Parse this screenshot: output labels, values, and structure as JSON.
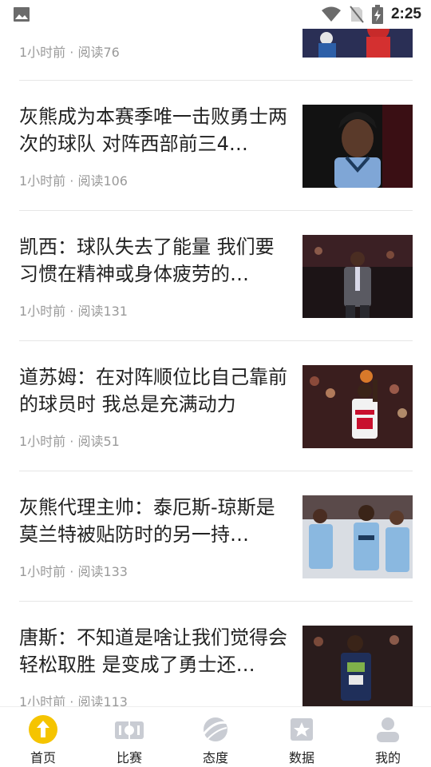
{
  "status_bar": {
    "time": "2:25",
    "icons": [
      "image-icon",
      "wifi-icon",
      "no-sim-icon",
      "battery-charging-icon"
    ]
  },
  "articles": [
    {
      "title": "",
      "meta": "1小时前 · 阅读76"
    },
    {
      "title": "灰熊成为本赛季唯一击败勇士两次的球队 对阵西部前三4…",
      "meta": "1小时前 · 阅读106"
    },
    {
      "title": "凯西：球队失去了能量 我们要习惯在精神或身体疲劳的…",
      "meta": "1小时前 · 阅读131"
    },
    {
      "title": "道苏姆：在对阵顺位比自己靠前的球员时 我总是充满动力",
      "meta": "1小时前 · 阅读51"
    },
    {
      "title": "灰熊代理主帅：泰厄斯-琼斯是莫兰特被贴防时的另一持…",
      "meta": "1小时前 · 阅读133"
    },
    {
      "title": "唐斯：不知道是啥让我们觉得会轻松取胜 是变成了勇士还…",
      "meta": "1小时前 · 阅读113"
    }
  ],
  "bottom_nav": [
    {
      "label": "首页",
      "icon": "home-up-arrow-icon",
      "active": true
    },
    {
      "label": "比赛",
      "icon": "match-icon",
      "active": false
    },
    {
      "label": "态度",
      "icon": "attitude-icon",
      "active": false
    },
    {
      "label": "数据",
      "icon": "data-icon",
      "active": false
    },
    {
      "label": "我的",
      "icon": "profile-icon",
      "active": false
    }
  ],
  "colors": {
    "accent": "#f5c400",
    "inactive_icon": "#c9ccd3",
    "text": "#222222",
    "meta": "#9a9a9a"
  }
}
